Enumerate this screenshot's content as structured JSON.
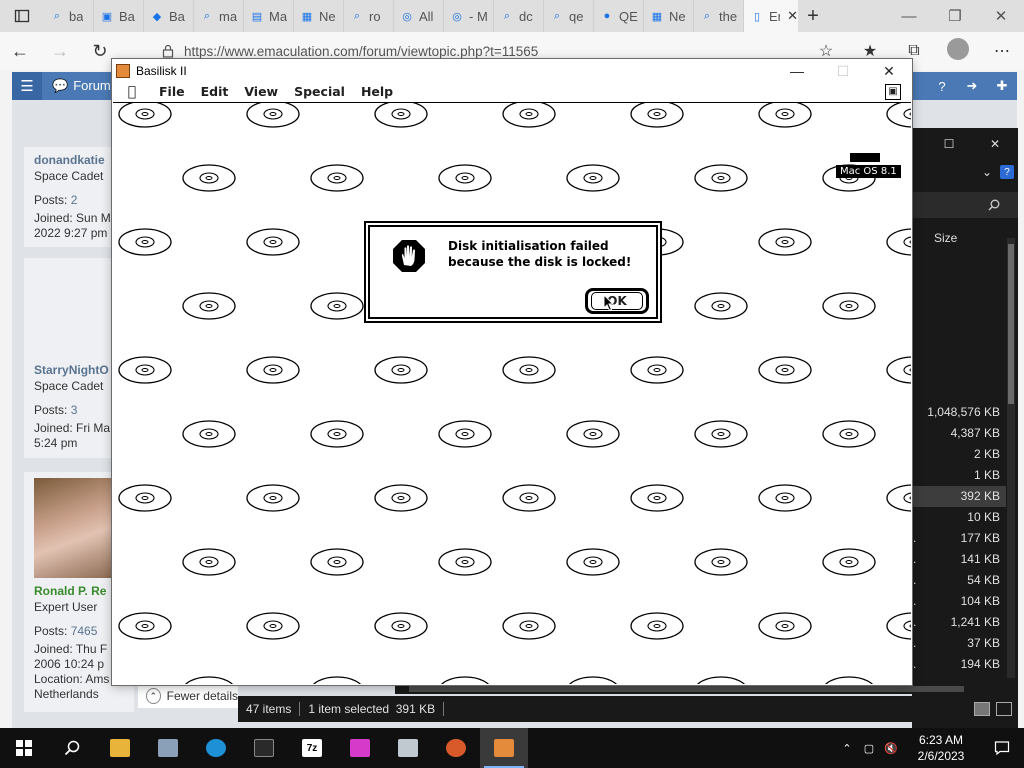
{
  "browser": {
    "tabs": [
      {
        "label": "ba",
        "icon": "search-icon"
      },
      {
        "label": "Ba",
        "icon": "floppy-icon"
      },
      {
        "label": "Ba",
        "icon": "diamond-icon"
      },
      {
        "label": "ma",
        "icon": "search-icon"
      },
      {
        "label": "Ma",
        "icon": "museum-icon"
      },
      {
        "label": "Ne",
        "icon": "newspaper-icon"
      },
      {
        "label": "ro",
        "icon": "search-icon"
      },
      {
        "label": "All",
        "icon": "globe-icon"
      },
      {
        "label": "- M",
        "icon": "globe-icon"
      },
      {
        "label": "dc",
        "icon": "search-icon"
      },
      {
        "label": "qe",
        "icon": "search-icon"
      },
      {
        "label": "QE",
        "icon": "game-icon"
      },
      {
        "label": "Ne",
        "icon": "newspaper-icon"
      },
      {
        "label": "the",
        "icon": "search-icon"
      },
      {
        "label": "Err",
        "icon": "page-icon",
        "active": true
      }
    ],
    "url": "https://www.emaculation.com/forum/viewtopic.php?t=11565"
  },
  "forum": {
    "nav_label": "Forum",
    "posts": [
      {
        "username": "donandkatie",
        "rank": "Space Cadet",
        "posts_label": "Posts:",
        "posts": "2",
        "joined": "Joined: Sun M",
        "joined2": "2022 9:27 pm"
      },
      {
        "username": "StarryNightO",
        "rank": "Space Cadet",
        "posts_label": "Posts:",
        "posts": "3",
        "joined": "Joined: Fri Ma",
        "joined2": "5:24 pm"
      },
      {
        "username": "Ronald P. Re",
        "rank": "Expert User",
        "posts_label": "Posts:",
        "posts": "7465",
        "joined": "Joined: Thu F",
        "joined2": "2006 10:24 p",
        "location": "Location: Ams",
        "location2": "Netherlands"
      }
    ]
  },
  "basilisk": {
    "title": "Basilisk II",
    "menu": [
      "File",
      "Edit",
      "View",
      "Special",
      "Help"
    ],
    "version_badge": "Mac OS 8.1",
    "alert": {
      "message": "Disk initialisation failed\nbecause the disk is locked!",
      "ok_label": "OK"
    }
  },
  "explorer": {
    "size_header": "Size",
    "sizes": [
      "1,048,576 KB",
      "4,387 KB",
      "2 KB",
      "1 KB",
      "392 KB",
      "10 KB",
      "177 KB",
      "141 KB",
      "54 KB",
      "104 KB",
      "1,241 KB",
      "37 KB",
      "194 KB"
    ],
    "selected_index": 4,
    "fewer_details": "Fewer details",
    "status_items": "47 items",
    "status_selected": "1 item selected  391 KB"
  },
  "taskbar": {
    "time": "6:23 AM",
    "date": "2/6/2023"
  }
}
